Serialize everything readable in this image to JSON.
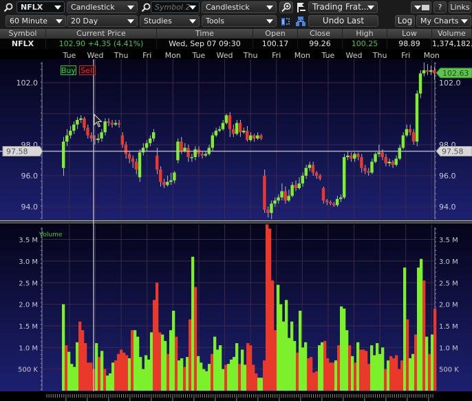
{
  "toolbar1": {
    "symbol_value": "NFLX",
    "chart_type_1": "Candlestick",
    "symbol2_placeholder": "Symbol 2",
    "chart_type_2": "Candlestick",
    "layout_select": "Trading Frat...",
    "help_label": "?",
    "links_label": "Links"
  },
  "toolbar2": {
    "interval": "60 Minute",
    "range": "20 Day",
    "studies": "Studies",
    "tools": "Tools",
    "undo_label": "Undo Last",
    "log_label": "Log",
    "my_charts": "My Charts"
  },
  "quote": {
    "headers": [
      "Symbol",
      "Current Price",
      "Time",
      "Open",
      "Close",
      "High",
      "Low",
      "Volume"
    ],
    "symbol": "NFLX",
    "current_price": "102.90  +4.35 (4.41%)",
    "time": "Wed, Sep 07  09:30",
    "open": "100.17",
    "close": "99.26",
    "high": "100.25",
    "low": "98.89",
    "volume": "1,374,182."
  },
  "colors": {
    "up": "#7cf02a",
    "down": "#e8392b",
    "wick": "#b9b6c8",
    "grid": "#3a2a4a",
    "crosshair": "#c9c9d6",
    "price_up_label": "#5fc44f"
  },
  "chart_data": [
    {
      "type": "candlestick",
      "title": "NFLX",
      "panel": "price",
      "x_labels": [
        "Tue",
        "Wed",
        "Thu",
        "Fri",
        "Mon",
        "Tue",
        "Wed",
        "Thu",
        "Fri",
        "Mon",
        "Tue",
        "Wed",
        "Thu",
        "Fri",
        "Mon"
      ],
      "y_ticks": [
        "102.0",
        "98.0",
        "96.0",
        "94.0"
      ],
      "ylim": [
        93.1,
        103.6
      ],
      "crosshair_price": "97.58",
      "last_price": "102.63",
      "buy_label": "Buy",
      "sell_label": "Sell",
      "candles": [
        [
          96.5,
          98.2,
          98.5,
          96.0
        ],
        [
          98.2,
          98.6,
          99.0,
          97.9
        ],
        [
          98.6,
          98.9,
          99.2,
          98.4
        ],
        [
          98.9,
          99.3,
          99.5,
          98.7
        ],
        [
          99.3,
          99.6,
          99.8,
          99.0
        ],
        [
          99.6,
          99.7,
          99.9,
          99.4
        ],
        [
          99.7,
          99.1,
          99.8,
          98.9
        ],
        [
          99.1,
          98.6,
          99.3,
          98.4
        ],
        [
          98.6,
          98.4,
          98.8,
          98.2
        ],
        [
          98.4,
          98.3,
          98.6,
          98.0
        ],
        [
          98.3,
          98.4,
          98.7,
          98.1
        ],
        [
          98.4,
          98.8,
          99.0,
          98.2
        ],
        [
          98.8,
          99.5,
          99.7,
          98.6
        ],
        [
          99.5,
          99.4,
          99.7,
          99.2
        ],
        [
          99.4,
          99.3,
          99.6,
          99.1
        ],
        [
          99.3,
          99.4,
          99.6,
          99.2
        ],
        [
          99.4,
          99.3,
          99.6,
          99.1
        ],
        [
          98.6,
          98.0,
          98.8,
          97.8
        ],
        [
          98.0,
          97.4,
          98.2,
          97.1
        ],
        [
          97.4,
          97.1,
          97.6,
          96.8
        ],
        [
          97.1,
          96.9,
          97.3,
          96.5
        ],
        [
          96.9,
          96.4,
          97.1,
          96.1
        ],
        [
          95.9,
          97.5,
          97.7,
          95.6
        ],
        [
          97.5,
          97.8,
          98.1,
          97.3
        ],
        [
          97.8,
          98.1,
          98.3,
          97.6
        ],
        [
          98.1,
          98.4,
          98.6,
          97.9
        ],
        [
          98.4,
          98.8,
          99.0,
          98.2
        ],
        [
          97.3,
          96.4,
          97.8,
          96.1
        ],
        [
          96.4,
          95.6,
          96.6,
          95.3
        ],
        [
          95.6,
          95.4,
          95.8,
          95.2
        ],
        [
          95.4,
          95.6,
          96.0,
          95.3
        ],
        [
          95.6,
          95.7,
          96.2,
          95.4
        ],
        [
          95.7,
          96.2,
          96.3,
          95.5
        ],
        [
          97.0,
          98.2,
          98.4,
          96.8
        ],
        [
          98.2,
          97.6,
          98.5,
          97.4
        ],
        [
          97.6,
          97.8,
          98.1,
          97.5
        ],
        [
          97.8,
          97.2,
          98.0,
          96.9
        ],
        [
          97.2,
          97.2,
          97.4,
          96.9
        ],
        [
          97.2,
          97.7,
          97.9,
          97.0
        ],
        [
          97.7,
          97.4,
          97.9,
          97.2
        ],
        [
          97.4,
          97.3,
          97.6,
          97.1
        ],
        [
          97.3,
          97.4,
          97.6,
          97.2
        ],
        [
          97.4,
          97.8,
          98.0,
          97.3
        ],
        [
          97.8,
          98.6,
          98.8,
          97.6
        ],
        [
          98.6,
          98.9,
          99.1,
          98.5
        ],
        [
          98.9,
          99.0,
          99.2,
          98.8
        ],
        [
          99.0,
          99.4,
          99.6,
          98.9
        ],
        [
          99.4,
          99.9,
          100.0,
          99.3
        ],
        [
          99.9,
          99.0,
          100.1,
          98.5
        ],
        [
          99.0,
          98.7,
          99.3,
          98.5
        ],
        [
          98.7,
          99.4,
          99.6,
          98.6
        ],
        [
          99.4,
          98.8,
          99.6,
          98.5
        ],
        [
          98.8,
          98.9,
          99.1,
          98.7
        ],
        [
          98.9,
          98.3,
          99.2,
          98.2
        ],
        [
          98.3,
          98.6,
          98.8,
          98.2
        ],
        [
          98.6,
          98.4,
          98.7,
          98.2
        ],
        [
          98.4,
          98.6,
          98.8,
          98.3
        ],
        [
          98.6,
          98.4,
          98.7,
          98.3
        ],
        [
          96.0,
          93.8,
          96.4,
          93.6
        ],
        [
          93.8,
          93.6,
          94.0,
          93.3
        ],
        [
          93.6,
          94.2,
          94.4,
          93.2
        ],
        [
          94.2,
          94.4,
          94.6,
          94.0
        ],
        [
          94.4,
          94.6,
          94.8,
          94.2
        ],
        [
          94.6,
          95.0,
          95.5,
          94.4
        ],
        [
          95.0,
          94.4,
          95.3,
          94.2
        ],
        [
          94.4,
          94.7,
          95.1,
          94.3
        ],
        [
          94.7,
          95.4,
          95.6,
          94.6
        ],
        [
          95.4,
          95.2,
          95.7,
          95.0
        ],
        [
          95.2,
          95.5,
          95.9,
          95.1
        ],
        [
          95.5,
          96.0,
          96.2,
          95.3
        ],
        [
          96.0,
          96.5,
          96.7,
          95.8
        ],
        [
          96.5,
          96.7,
          96.9,
          96.3
        ],
        [
          96.7,
          96.2,
          96.9,
          96.0
        ],
        [
          96.2,
          96.0,
          96.3,
          95.8
        ],
        [
          96.0,
          95.8,
          96.1,
          95.7
        ],
        [
          95.2,
          94.4,
          95.3,
          94.2
        ],
        [
          94.4,
          94.3,
          94.5,
          94.1
        ],
        [
          94.3,
          94.2,
          94.4,
          94.1
        ],
        [
          94.2,
          94.1,
          94.3,
          94.0
        ],
        [
          94.1,
          94.5,
          94.7,
          94.0
        ],
        [
          94.5,
          94.6,
          94.8,
          94.3
        ],
        [
          94.6,
          97.2,
          97.4,
          94.5
        ],
        [
          97.2,
          97.3,
          97.6,
          97.0
        ],
        [
          97.3,
          97.1,
          97.5,
          96.9
        ],
        [
          97.1,
          97.4,
          97.5,
          96.9
        ],
        [
          97.4,
          97.2,
          97.5,
          97.0
        ],
        [
          97.2,
          96.5,
          97.4,
          96.2
        ],
        [
          96.5,
          96.3,
          96.7,
          96.1
        ],
        [
          96.3,
          96.2,
          96.5,
          96.0
        ],
        [
          96.2,
          96.9,
          97.1,
          96.1
        ],
        [
          96.9,
          97.4,
          97.5,
          96.8
        ],
        [
          97.4,
          97.5,
          98.0,
          97.2
        ],
        [
          97.5,
          97.2,
          97.7,
          97.0
        ],
        [
          97.2,
          96.8,
          97.4,
          96.6
        ],
        [
          96.8,
          96.9,
          97.1,
          96.6
        ],
        [
          96.9,
          96.7,
          97.0,
          96.5
        ],
        [
          96.7,
          97.1,
          97.3,
          96.6
        ],
        [
          97.1,
          97.8,
          98.0,
          97.0
        ],
        [
          97.8,
          98.6,
          98.8,
          97.7
        ],
        [
          98.6,
          99.0,
          99.3,
          98.5
        ],
        [
          99.0,
          98.8,
          99.3,
          98.6
        ],
        [
          98.8,
          98.2,
          99.0,
          98.0
        ],
        [
          98.2,
          101.3,
          101.5,
          97.9
        ],
        [
          101.3,
          102.6,
          102.8,
          101.0
        ],
        [
          102.6,
          102.8,
          103.3,
          102.4
        ],
        [
          102.8,
          102.7,
          103.2,
          102.5
        ],
        [
          102.7,
          102.8,
          103.1,
          102.5
        ],
        [
          102.8,
          102.6,
          103.0,
          102.2
        ]
      ]
    },
    {
      "type": "bar",
      "title": "Volume",
      "panel": "volume",
      "y_ticks": [
        "3.5 M",
        "3.0 M",
        "2.5 M",
        "2.0 M",
        "1.5 M",
        "1.0 M",
        "500 K"
      ],
      "ylim": [
        0,
        3.85
      ],
      "unit": "millions",
      "values": [
        2.0,
        1.05,
        0.9,
        0.62,
        0.55,
        1.12,
        1.6,
        1.4,
        1.1,
        0.65,
        0.65,
        0.5,
        1.1,
        0.78,
        0.92,
        0.5,
        0.35,
        0.4,
        0.65,
        0.7,
        0.85,
        0.95,
        0.88,
        0.82,
        0.75,
        1.4,
        1.4,
        1.25,
        0.78,
        0.5,
        0.82,
        0.72,
        1.35,
        2.1,
        2.5,
        1.35,
        1.3,
        1.15,
        0.85,
        1.4,
        1.85,
        1.25,
        0.7,
        0.75,
        0.55,
        0.78,
        1.65,
        3.1,
        2.4,
        0.8,
        0.65,
        0.5,
        0.45,
        0.62,
        0.85,
        1.25,
        0.95,
        1.05,
        0.5,
        0.6,
        0.62,
        0.72,
        0.78,
        1.1,
        0.62,
        0.95,
        0.6,
        1.1,
        1.05,
        0.6,
        0.4,
        0.3,
        0.3,
        0.7,
        3.85,
        3.75,
        2.55,
        1.4,
        2.45,
        2.0,
        1.6,
        2.1,
        1.22,
        1.6,
        1.15,
        0.88,
        1.85,
        1.0,
        1.12,
        0.75,
        0.78,
        0.42,
        0.45,
        1.05,
        1.12,
        1.15,
        0.75,
        0.65,
        0.65,
        0.7,
        1.05,
        1.95,
        1.9,
        1.4,
        1.05,
        0.8,
        0.65,
        1.12,
        0.95,
        0.95,
        0.92,
        0.62,
        1.05,
        0.82,
        1.1,
        0.85,
        1.0,
        0.5,
        0.7,
        0.8,
        0.75,
        0.82,
        0.5,
        0.7,
        2.85,
        1.65,
        0.75,
        0.85,
        1.3,
        2.85,
        3.05,
        2.55,
        1.25,
        0.85,
        1.3,
        1.9
      ],
      "up": [
        1,
        0,
        1,
        1,
        1,
        1,
        0,
        0,
        0,
        0,
        0,
        0,
        1,
        0,
        1,
        0,
        1,
        1,
        1,
        0,
        0,
        0,
        0,
        0,
        1,
        0,
        1,
        1,
        1,
        1,
        1,
        1,
        1,
        0,
        0,
        0,
        1,
        1,
        0,
        1,
        1,
        0,
        1,
        1,
        0,
        1,
        0,
        1,
        0,
        1,
        1,
        1,
        1,
        1,
        0,
        1,
        1,
        1,
        1,
        0,
        1,
        1,
        1,
        1,
        0,
        1,
        1,
        0,
        0,
        0,
        0,
        1,
        1,
        0,
        0,
        0,
        0,
        0,
        1,
        1,
        1,
        1,
        1,
        1,
        1,
        0,
        1,
        1,
        1,
        0,
        0,
        0,
        0,
        1,
        1,
        0,
        0,
        0,
        0,
        1,
        0,
        1,
        1,
        1,
        0,
        1,
        0,
        1,
        0,
        0,
        0,
        0,
        1,
        1,
        1,
        1,
        1,
        0,
        1,
        0,
        0,
        0,
        0,
        0,
        1,
        0,
        1,
        1,
        0,
        1,
        1,
        0,
        1,
        0,
        1,
        0
      ]
    }
  ]
}
